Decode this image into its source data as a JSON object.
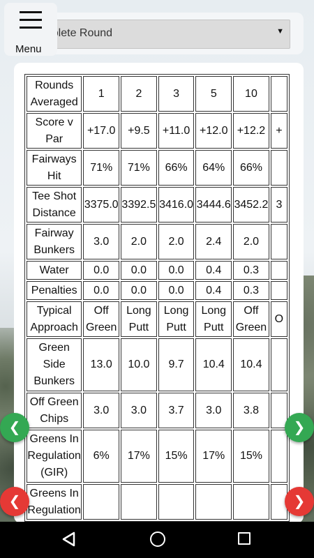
{
  "menu": {
    "label": "Menu",
    "icon": "hamburger-menu-icon"
  },
  "round_select": {
    "value": "Complete Round",
    "icon": "dropdown-arrow-icon"
  },
  "stats_table": {
    "header": {
      "label": "Rounds Averaged",
      "values": [
        "1",
        "2",
        "3",
        "5",
        "10",
        ""
      ]
    },
    "rows": [
      {
        "label": "Score v Par",
        "values": [
          "+17.0",
          "+9.5",
          "+11.0",
          "+12.0",
          "+12.2",
          "+"
        ]
      },
      {
        "label": "Fairways Hit",
        "values": [
          "71%",
          "71%",
          "66%",
          "64%",
          "66%",
          ""
        ]
      },
      {
        "label": "Tee Shot Distance",
        "values": [
          "3375.0",
          "3392.5",
          "3416.0",
          "3444.6",
          "3452.2",
          "3"
        ]
      },
      {
        "label": "Fairway Bunkers",
        "values": [
          "3.0",
          "2.0",
          "2.0",
          "2.4",
          "2.0",
          ""
        ]
      },
      {
        "label": "Water",
        "values": [
          "0.0",
          "0.0",
          "0.0",
          "0.4",
          "0.3",
          ""
        ]
      },
      {
        "label": "Penalties",
        "values": [
          "0.0",
          "0.0",
          "0.0",
          "0.4",
          "0.3",
          ""
        ]
      },
      {
        "label": "Typical Approach",
        "values": [
          "Off Green",
          "Long Putt",
          "Long Putt",
          "Long Putt",
          "Off Green",
          "O"
        ]
      },
      {
        "label": "Green Side Bunkers",
        "values": [
          "13.0",
          "10.0",
          "9.7",
          "10.4",
          "10.4",
          ""
        ]
      },
      {
        "label": "Off Green Chips",
        "values": [
          "3.0",
          "3.0",
          "3.7",
          "3.0",
          "3.8",
          ""
        ]
      },
      {
        "label": "Greens In Regulation (GIR)",
        "values": [
          "6%",
          "17%",
          "15%",
          "17%",
          "15%",
          ""
        ]
      },
      {
        "label": "Greens In Regulation",
        "values": [
          "",
          "",
          "",
          "",
          "",
          ""
        ]
      }
    ]
  },
  "nav_arrows": {
    "left_green": "❮",
    "right_green": "❯",
    "left_red": "❮",
    "right_red": "❯",
    "colors": {
      "green": "#34a853",
      "red": "#e53935"
    }
  },
  "system_nav": {
    "back": "back-icon",
    "home": "home-icon",
    "recents": "recents-icon"
  }
}
